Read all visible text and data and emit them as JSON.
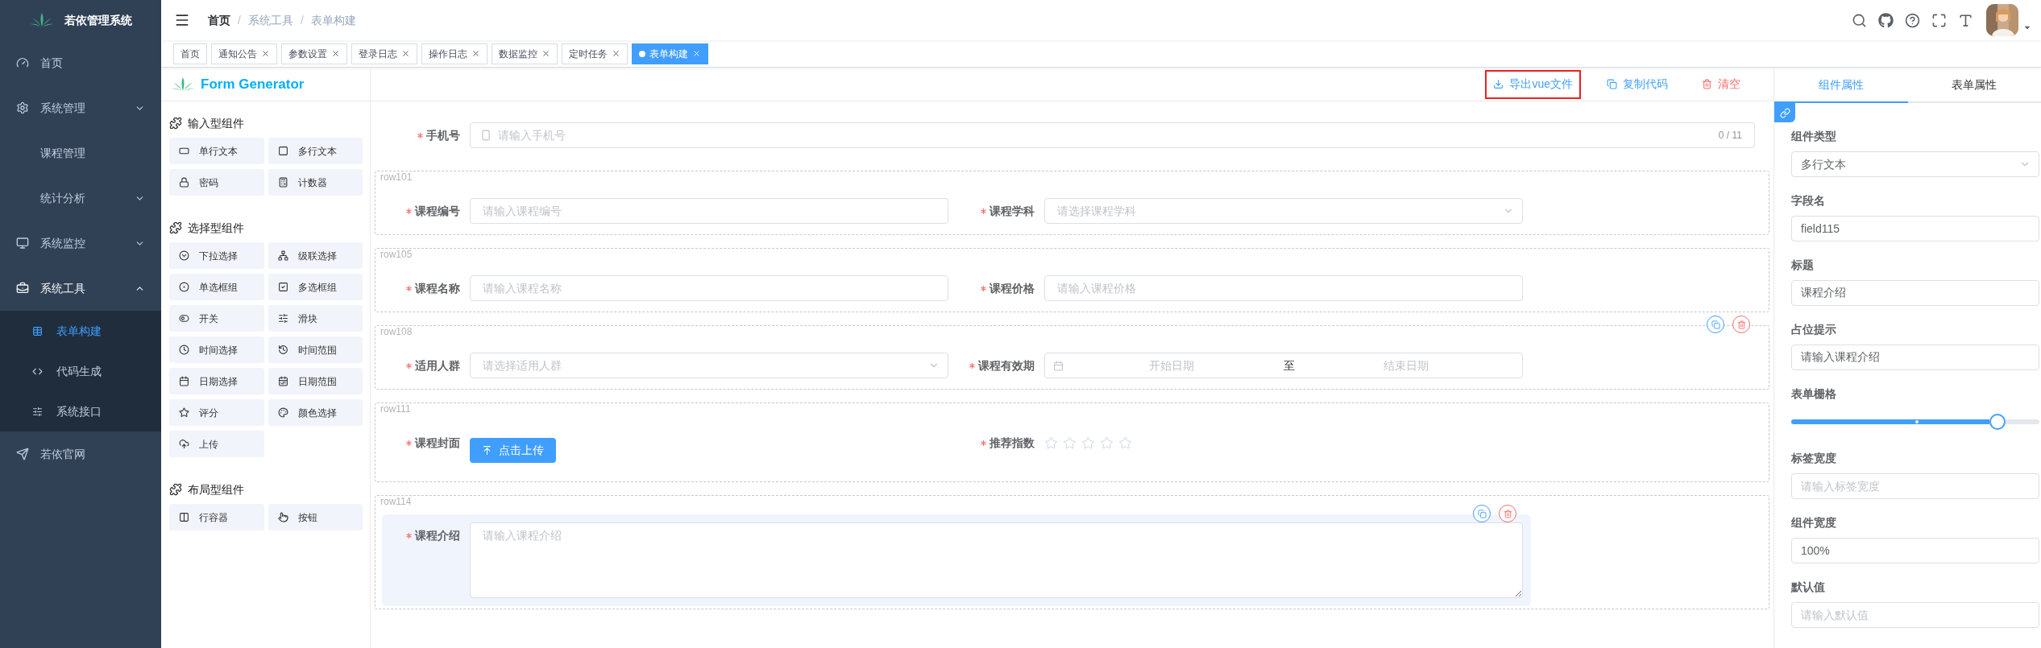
{
  "sidebar": {
    "title": "若依管理系统",
    "menu": [
      {
        "label": "首页",
        "selected": false
      },
      {
        "label": "系统管理",
        "selected": false,
        "expanded": false
      },
      {
        "label": "课程管理",
        "selected": false
      },
      {
        "label": "统计分析",
        "selected": false,
        "expanded": false
      },
      {
        "label": "系统监控",
        "selected": false,
        "expanded": false
      },
      {
        "label": "系统工具",
        "selected": true,
        "expanded": true,
        "children": [
          {
            "label": "表单构建",
            "selected": true
          },
          {
            "label": "代码生成",
            "selected": false
          },
          {
            "label": "系统接口",
            "selected": false
          }
        ]
      },
      {
        "label": "若依官网",
        "selected": false
      }
    ]
  },
  "header": {
    "breadcrumb": [
      {
        "label": "首页",
        "link": true
      },
      {
        "label": "系统工具",
        "link": false,
        "separator": "/"
      },
      {
        "label": "表单构建",
        "link": false,
        "separator": "/"
      }
    ]
  },
  "tags": [
    {
      "label": "首页",
      "closable": false,
      "selected": false
    },
    {
      "label": "通知公告",
      "closable": true,
      "selected": false
    },
    {
      "label": "参数设置",
      "closable": true,
      "selected": false
    },
    {
      "label": "登录日志",
      "closable": true,
      "selected": false
    },
    {
      "label": "操作日志",
      "closable": true,
      "selected": false
    },
    {
      "label": "数据监控",
      "closable": true,
      "selected": false
    },
    {
      "label": "定时任务",
      "closable": true,
      "selected": false
    },
    {
      "label": "表单构建",
      "closable": true,
      "selected": true
    }
  ],
  "palette": {
    "title": "Form Generator",
    "groups": [
      {
        "title": "输入型组件",
        "items": [
          {
            "label": "单行文本",
            "kind": "input"
          },
          {
            "label": "多行文本",
            "kind": "textarea"
          },
          {
            "label": "密码",
            "kind": "password"
          },
          {
            "label": "计数器",
            "kind": "number"
          }
        ]
      },
      {
        "title": "选择型组件",
        "items": [
          {
            "label": "下拉选择",
            "kind": "select"
          },
          {
            "label": "级联选择",
            "kind": "cascader"
          },
          {
            "label": "单选框组",
            "kind": "radio"
          },
          {
            "label": "多选框组",
            "kind": "checkbox"
          },
          {
            "label": "开关",
            "kind": "switch"
          },
          {
            "label": "滑块",
            "kind": "slider"
          },
          {
            "label": "时间选择",
            "kind": "time"
          },
          {
            "label": "时间范围",
            "kind": "time-range"
          },
          {
            "label": "日期选择",
            "kind": "date"
          },
          {
            "label": "日期范围",
            "kind": "date-range"
          },
          {
            "label": "评分",
            "kind": "rate"
          },
          {
            "label": "颜色选择",
            "kind": "color"
          },
          {
            "label": "上传",
            "kind": "upload"
          }
        ]
      },
      {
        "title": "布局型组件",
        "items": [
          {
            "label": "行容器",
            "kind": "row"
          },
          {
            "label": "按钮",
            "kind": "button"
          }
        ]
      }
    ]
  },
  "toolbar": [
    {
      "label": "导出vue文件",
      "kind": "download",
      "highlighted": true
    },
    {
      "label": "复制代码",
      "kind": "copy",
      "highlighted": false
    },
    {
      "label": "清空",
      "kind": "clear",
      "highlighted": false
    }
  ],
  "form": {
    "items": [
      {
        "kind": "field",
        "field": {
          "label": "手机号",
          "required": true,
          "kind": "phone",
          "placeholder": "请输入手机号",
          "counter": "0 / 11",
          "selected": false
        }
      },
      {
        "kind": "row",
        "name": "row101",
        "show_actions": false,
        "fields": [
          {
            "label": "课程编号",
            "required": true,
            "kind": "input",
            "placeholder": "请输入课程编号",
            "selected": false
          },
          {
            "label": "课程学科",
            "required": true,
            "kind": "select",
            "placeholder": "请选择课程学科",
            "selected": false
          }
        ]
      },
      {
        "kind": "row",
        "name": "row105",
        "show_actions": false,
        "fields": [
          {
            "label": "课程名称",
            "required": true,
            "kind": "input",
            "placeholder": "请输入课程名称",
            "selected": false
          },
          {
            "label": "课程价格",
            "required": true,
            "kind": "input",
            "placeholder": "请输入课程价格",
            "selected": false
          }
        ]
      },
      {
        "kind": "row",
        "name": "row108",
        "show_actions": true,
        "fields": [
          {
            "label": "适用人群",
            "required": true,
            "kind": "select",
            "placeholder": "请选择适用人群",
            "selected": false
          },
          {
            "label": "课程有效期",
            "required": true,
            "kind": "daterange",
            "start_placeholder": "开始日期",
            "separator": "至",
            "end_placeholder": "结束日期",
            "selected": false
          }
        ]
      },
      {
        "kind": "row",
        "name": "row111",
        "show_actions": false,
        "fields": [
          {
            "label": "课程封面",
            "required": true,
            "kind": "upload",
            "button": "点击上传",
            "selected": false
          },
          {
            "label": "推荐指数",
            "required": true,
            "kind": "rate",
            "stars": 0,
            "selected": false
          }
        ]
      },
      {
        "kind": "row",
        "name": "row114",
        "show_actions": false,
        "fields": [
          {
            "label": "课程介绍",
            "required": true,
            "kind": "textarea",
            "placeholder": "请输入课程介绍",
            "selected": true
          }
        ]
      }
    ]
  },
  "properties": {
    "tabs": [
      {
        "label": "组件属性",
        "selected": true
      },
      {
        "label": "表单属性",
        "selected": false
      }
    ],
    "fields": [
      {
        "kind": "select",
        "label": "组件类型",
        "value": "多行文本"
      },
      {
        "kind": "input",
        "label": "字段名",
        "value": "field115"
      },
      {
        "kind": "input",
        "label": "标题",
        "value": "课程介绍"
      },
      {
        "kind": "input",
        "label": "占位提示",
        "value": "请输入课程介绍"
      },
      {
        "kind": "slider",
        "label": "表单栅格",
        "level": 0.83
      },
      {
        "kind": "input",
        "label": "标签宽度",
        "placeholder": "请输入标签宽度"
      },
      {
        "kind": "input",
        "label": "组件宽度",
        "value": "100%"
      },
      {
        "kind": "input",
        "label": "默认值",
        "placeholder": "请输入默认值"
      }
    ]
  }
}
